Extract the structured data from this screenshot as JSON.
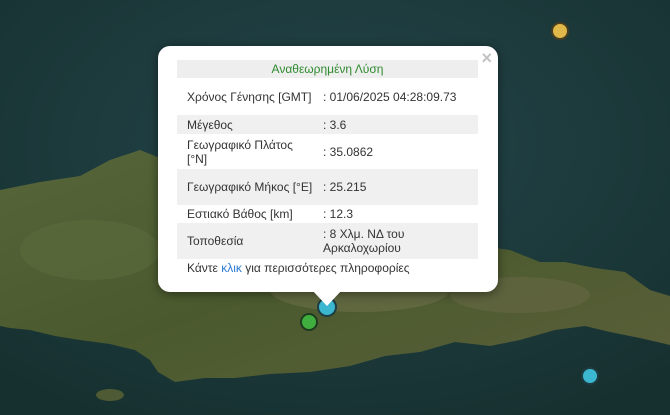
{
  "popup": {
    "title": "Αναθεωρημένη Λύση",
    "close_label": "×",
    "rows": [
      {
        "key": "Χρόνος Γένησης [GMT]",
        "value": ": 01/06/2025 04:28:09.73"
      },
      {
        "key": "Μέγεθος",
        "value": ": 3.6"
      },
      {
        "key": "Γεωγραφικό Πλάτος [°N]",
        "value": ": 35.0862"
      },
      {
        "key": "Γεωγραφικό Μήκος [°E]",
        "value": ": 25.215"
      },
      {
        "key": "Εστιακό Βάθος [km]",
        "value": ": 12.3"
      },
      {
        "key": "Τοποθεσία",
        "value": ": 8 Χλμ. ΝΔ του Αρκαλοχωρίου"
      }
    ],
    "more_prefix": "Κάντε ",
    "more_link": "κλικ",
    "more_suffix": " για περισσότερες πληροφορίες"
  },
  "colors": {
    "sea": "#1b3a3a",
    "land": "#4a5a2c",
    "marker_yellow": "#e0b84a",
    "marker_cyan": "#3bb8d0",
    "marker_green": "#3fae3f"
  }
}
